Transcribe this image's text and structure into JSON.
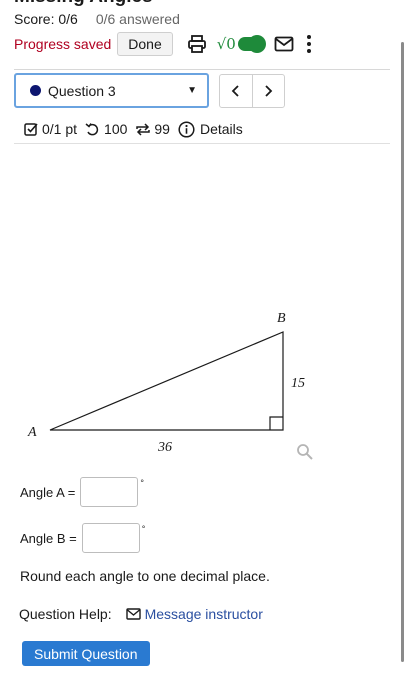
{
  "page": {
    "title": "Missing Angles"
  },
  "score": {
    "label": "Score: 0/6",
    "answered": "0/6 answered"
  },
  "toolbar": {
    "progress_saved": "Progress saved",
    "done_label": "Done",
    "sqrt_label": "√0",
    "toggle_on": true,
    "toggle_color": "#1e8a3a"
  },
  "question_select": {
    "selected": "Question 3",
    "dot_color": "#0d1670"
  },
  "nav": {
    "prev": "‹",
    "next": "›"
  },
  "meta": {
    "points": "0/1 pt",
    "retries": "100",
    "attempts": "99",
    "details": "Details"
  },
  "diagram": {
    "vertex_a": "A",
    "vertex_b": "B",
    "side_bottom": "36",
    "side_right": "15",
    "right_angle_at": "C"
  },
  "form": {
    "angle_a_label": "Angle A =",
    "angle_a_value": "",
    "angle_b_label": "Angle B =",
    "angle_b_value": "",
    "degree_symbol": "°"
  },
  "instructions": "Round each angle to one decimal place.",
  "help": {
    "label": "Question Help:",
    "message_link": "Message instructor"
  },
  "submit_label": "Submit Question",
  "accent_color": "#2a7ad1"
}
